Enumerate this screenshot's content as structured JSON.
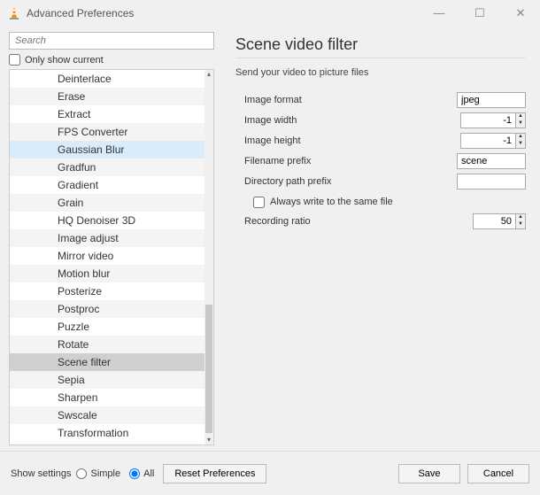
{
  "window": {
    "title": "Advanced Preferences",
    "minimize": "—",
    "maximize": "☐",
    "close": "✕"
  },
  "left": {
    "search_placeholder": "Search",
    "only_current": "Only show current",
    "items": [
      {
        "label": "Deinterlace",
        "z": "z0"
      },
      {
        "label": "Erase",
        "z": "z1"
      },
      {
        "label": "Extract",
        "z": "z0"
      },
      {
        "label": "FPS Converter",
        "z": "z1"
      },
      {
        "label": "Gaussian Blur",
        "z": "hl"
      },
      {
        "label": "Gradfun",
        "z": "z1"
      },
      {
        "label": "Gradient",
        "z": "z0"
      },
      {
        "label": "Grain",
        "z": "z1"
      },
      {
        "label": "HQ Denoiser 3D",
        "z": "z0"
      },
      {
        "label": "Image adjust",
        "z": "z1"
      },
      {
        "label": "Mirror video",
        "z": "z0"
      },
      {
        "label": "Motion blur",
        "z": "z1"
      },
      {
        "label": "Posterize",
        "z": "z0"
      },
      {
        "label": "Postproc",
        "z": "z1"
      },
      {
        "label": "Puzzle",
        "z": "z0"
      },
      {
        "label": "Rotate",
        "z": "z1"
      },
      {
        "label": "Scene filter",
        "z": "sel"
      },
      {
        "label": "Sepia",
        "z": "z1"
      },
      {
        "label": "Sharpen",
        "z": "z0"
      },
      {
        "label": "Swscale",
        "z": "z1"
      },
      {
        "label": "Transformation",
        "z": "z0"
      }
    ]
  },
  "right": {
    "title": "Scene video filter",
    "desc": "Send your video to picture files",
    "image_format_label": "Image format",
    "image_format_value": "jpeg",
    "image_width_label": "Image width",
    "image_width_value": "-1",
    "image_height_label": "Image height",
    "image_height_value": "-1",
    "filename_prefix_label": "Filename prefix",
    "filename_prefix_value": "scene",
    "dir_prefix_label": "Directory path prefix",
    "dir_prefix_value": "",
    "always_write_label": "Always write to the same file",
    "recording_ratio_label": "Recording ratio",
    "recording_ratio_value": "50"
  },
  "footer": {
    "show_settings": "Show settings",
    "simple": "Simple",
    "all": "All",
    "reset": "Reset Preferences",
    "save": "Save",
    "cancel": "Cancel"
  }
}
